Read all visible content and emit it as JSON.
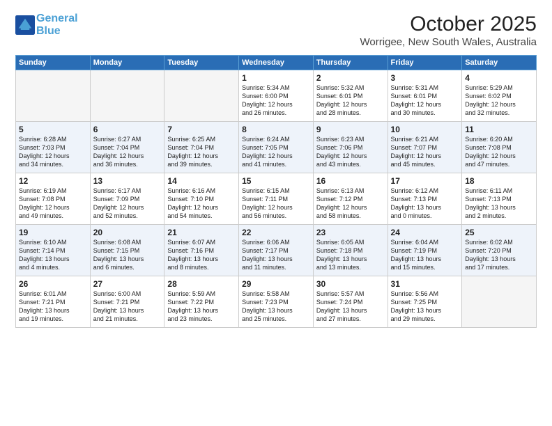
{
  "header": {
    "logo_line1": "General",
    "logo_line2": "Blue",
    "month": "October 2025",
    "location": "Worrigee, New South Wales, Australia"
  },
  "weekdays": [
    "Sunday",
    "Monday",
    "Tuesday",
    "Wednesday",
    "Thursday",
    "Friday",
    "Saturday"
  ],
  "rows": [
    [
      {
        "day": "",
        "info": ""
      },
      {
        "day": "",
        "info": ""
      },
      {
        "day": "",
        "info": ""
      },
      {
        "day": "1",
        "info": "Sunrise: 5:34 AM\nSunset: 6:00 PM\nDaylight: 12 hours\nand 26 minutes."
      },
      {
        "day": "2",
        "info": "Sunrise: 5:32 AM\nSunset: 6:01 PM\nDaylight: 12 hours\nand 28 minutes."
      },
      {
        "day": "3",
        "info": "Sunrise: 5:31 AM\nSunset: 6:01 PM\nDaylight: 12 hours\nand 30 minutes."
      },
      {
        "day": "4",
        "info": "Sunrise: 5:29 AM\nSunset: 6:02 PM\nDaylight: 12 hours\nand 32 minutes."
      }
    ],
    [
      {
        "day": "5",
        "info": "Sunrise: 6:28 AM\nSunset: 7:03 PM\nDaylight: 12 hours\nand 34 minutes."
      },
      {
        "day": "6",
        "info": "Sunrise: 6:27 AM\nSunset: 7:04 PM\nDaylight: 12 hours\nand 36 minutes."
      },
      {
        "day": "7",
        "info": "Sunrise: 6:25 AM\nSunset: 7:04 PM\nDaylight: 12 hours\nand 39 minutes."
      },
      {
        "day": "8",
        "info": "Sunrise: 6:24 AM\nSunset: 7:05 PM\nDaylight: 12 hours\nand 41 minutes."
      },
      {
        "day": "9",
        "info": "Sunrise: 6:23 AM\nSunset: 7:06 PM\nDaylight: 12 hours\nand 43 minutes."
      },
      {
        "day": "10",
        "info": "Sunrise: 6:21 AM\nSunset: 7:07 PM\nDaylight: 12 hours\nand 45 minutes."
      },
      {
        "day": "11",
        "info": "Sunrise: 6:20 AM\nSunset: 7:08 PM\nDaylight: 12 hours\nand 47 minutes."
      }
    ],
    [
      {
        "day": "12",
        "info": "Sunrise: 6:19 AM\nSunset: 7:08 PM\nDaylight: 12 hours\nand 49 minutes."
      },
      {
        "day": "13",
        "info": "Sunrise: 6:17 AM\nSunset: 7:09 PM\nDaylight: 12 hours\nand 52 minutes."
      },
      {
        "day": "14",
        "info": "Sunrise: 6:16 AM\nSunset: 7:10 PM\nDaylight: 12 hours\nand 54 minutes."
      },
      {
        "day": "15",
        "info": "Sunrise: 6:15 AM\nSunset: 7:11 PM\nDaylight: 12 hours\nand 56 minutes."
      },
      {
        "day": "16",
        "info": "Sunrise: 6:13 AM\nSunset: 7:12 PM\nDaylight: 12 hours\nand 58 minutes."
      },
      {
        "day": "17",
        "info": "Sunrise: 6:12 AM\nSunset: 7:13 PM\nDaylight: 13 hours\nand 0 minutes."
      },
      {
        "day": "18",
        "info": "Sunrise: 6:11 AM\nSunset: 7:13 PM\nDaylight: 13 hours\nand 2 minutes."
      }
    ],
    [
      {
        "day": "19",
        "info": "Sunrise: 6:10 AM\nSunset: 7:14 PM\nDaylight: 13 hours\nand 4 minutes."
      },
      {
        "day": "20",
        "info": "Sunrise: 6:08 AM\nSunset: 7:15 PM\nDaylight: 13 hours\nand 6 minutes."
      },
      {
        "day": "21",
        "info": "Sunrise: 6:07 AM\nSunset: 7:16 PM\nDaylight: 13 hours\nand 8 minutes."
      },
      {
        "day": "22",
        "info": "Sunrise: 6:06 AM\nSunset: 7:17 PM\nDaylight: 13 hours\nand 11 minutes."
      },
      {
        "day": "23",
        "info": "Sunrise: 6:05 AM\nSunset: 7:18 PM\nDaylight: 13 hours\nand 13 minutes."
      },
      {
        "day": "24",
        "info": "Sunrise: 6:04 AM\nSunset: 7:19 PM\nDaylight: 13 hours\nand 15 minutes."
      },
      {
        "day": "25",
        "info": "Sunrise: 6:02 AM\nSunset: 7:20 PM\nDaylight: 13 hours\nand 17 minutes."
      }
    ],
    [
      {
        "day": "26",
        "info": "Sunrise: 6:01 AM\nSunset: 7:21 PM\nDaylight: 13 hours\nand 19 minutes."
      },
      {
        "day": "27",
        "info": "Sunrise: 6:00 AM\nSunset: 7:21 PM\nDaylight: 13 hours\nand 21 minutes."
      },
      {
        "day": "28",
        "info": "Sunrise: 5:59 AM\nSunset: 7:22 PM\nDaylight: 13 hours\nand 23 minutes."
      },
      {
        "day": "29",
        "info": "Sunrise: 5:58 AM\nSunset: 7:23 PM\nDaylight: 13 hours\nand 25 minutes."
      },
      {
        "day": "30",
        "info": "Sunrise: 5:57 AM\nSunset: 7:24 PM\nDaylight: 13 hours\nand 27 minutes."
      },
      {
        "day": "31",
        "info": "Sunrise: 5:56 AM\nSunset: 7:25 PM\nDaylight: 13 hours\nand 29 minutes."
      },
      {
        "day": "",
        "info": ""
      }
    ]
  ]
}
